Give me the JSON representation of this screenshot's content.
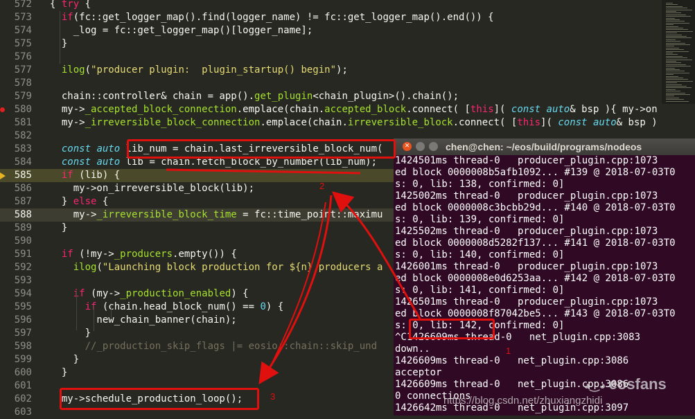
{
  "editor": {
    "lines": [
      {
        "n": "572",
        "html": "<span>{ </span><span class='kw'>try</span><span> {</span>"
      },
      {
        "n": "573",
        "html": "  <span class='kw'>if</span>(fc::get_logger_map().find(logger_name) != fc::get_logger_map().end()) {"
      },
      {
        "n": "574",
        "html": "    _log = fc::get_logger_map()[logger_name];"
      },
      {
        "n": "575",
        "html": "  }"
      },
      {
        "n": "576",
        "html": ""
      },
      {
        "n": "577",
        "html": "  <span class='gr'>ilog</span>(<span class='str'>\"producer plugin:  plugin_startup() begin\"</span>);"
      },
      {
        "n": "578",
        "html": ""
      },
      {
        "n": "579",
        "html": "  chain::controller&amp; chain = app().<span class='gr'>get_plugin</span>&lt;chain_plugin&gt;().chain();"
      },
      {
        "n": "580",
        "html": "  my-&gt;<span class='gr'>_accepted_block_connection</span>.emplace(chain.<span class='gr'>accepted_block</span>.connect( [<span class='kw'>this</span>]( <span class='ty'>const</span> <span class='ty'>auto</span>&amp; bsp ){ my-&gt;on"
      },
      {
        "n": "581",
        "html": "  my-&gt;<span class='gr'>_irreversible_block_connection</span>.emplace(chain.<span class='gr'>irreversible_block</span>.connect( [<span class='kw'>this</span>]( <span class='ty'>const</span> <span class='ty'>auto</span>&amp; bsp )"
      },
      {
        "n": "582",
        "html": ""
      },
      {
        "n": "583",
        "html": "  <span class='ty'>const</span> <span class='ty'>auto</span> lib_num = chain.last_irreversible_block_num("
      },
      {
        "n": "584",
        "html": "  <span class='ty'>const</span> <span class='ty'>auto</span> lib = chain.fetch_block_by_number(lib_num);"
      },
      {
        "n": "585",
        "html": "  <span class='kw'>if</span> (lib) {"
      },
      {
        "n": "586",
        "html": "    my-&gt;on_irreversible_block(lib);"
      },
      {
        "n": "587",
        "html": "  } <span class='kw'>else</span> {"
      },
      {
        "n": "588",
        "html": "    my-&gt;<span class='gr'>_irreversible_block_time</span> = fc::time_point::maximu"
      },
      {
        "n": "589",
        "html": "  }"
      },
      {
        "n": "590",
        "html": ""
      },
      {
        "n": "591",
        "html": "  <span class='kw'>if</span> (!my-&gt;<span class='gr'>_producers</span>.empty()) {"
      },
      {
        "n": "592",
        "html": "    <span class='gr'>ilog</span>(<span class='str'>\"Launching block production for ${n} producers a</span>"
      },
      {
        "n": "593",
        "html": ""
      },
      {
        "n": "594",
        "html": "    <span class='kw'>if</span> (my-&gt;<span class='gr'>_production_enabled</span>) {"
      },
      {
        "n": "595",
        "html": "      <span class='kw'>if</span> (chain.head_block_num() == <span class='fn'>0</span>) {"
      },
      {
        "n": "596",
        "html": "        new_chain_banner(chain);"
      },
      {
        "n": "597",
        "html": "      }"
      },
      {
        "n": "598",
        "html": "      <span class='cm'>//_production_skip_flags |= eosio::chain::skip_und</span>"
      },
      {
        "n": "599",
        "html": "    }"
      },
      {
        "n": "600",
        "html": "  }"
      },
      {
        "n": "601",
        "html": ""
      },
      {
        "n": "602",
        "html": "  my-&gt;schedule_production_loop();"
      },
      {
        "n": "603",
        "html": ""
      }
    ]
  },
  "terminal": {
    "title": "chen@chen: ~/eos/build/programs/nodeos",
    "lines": [
      "1424501ms thread-0   producer_plugin.cpp:1073",
      "ed block 0000008b5afb1092... #139 @ 2018-07-03T0",
      "s: 0, lib: 138, confirmed: 0]",
      "1425002ms thread-0   producer_plugin.cpp:1073",
      "ed block 0000008c3bcbb29d... #140 @ 2018-07-03T0",
      "s: 0, lib: 139, confirmed: 0]",
      "1425502ms thread-0   producer_plugin.cpp:1073",
      "ed block 0000008d5282f137... #141 @ 2018-07-03T0",
      "s: 0, lib: 140, confirmed: 0]",
      "1426001ms thread-0   producer_plugin.cpp:1073",
      "ed block 0000008e0d6253aa... #142 @ 2018-07-03T0",
      "s: 0, lib: 141, confirmed: 0]",
      "1426501ms thread-0   producer_plugin.cpp:1073",
      "ed block 0000008f87042be5... #143 @ 2018-07-03T0",
      "s: 0, lib: 142, confirmed: 0]",
      "^C1426609ms thread-0   net_plugin.cpp:3083",
      "down..",
      "1426609ms thread-0   net_plugin.cpp:3086",
      "acceptor",
      "1426609ms thread-0   net_plugin.cpp:3086",
      "0 connections",
      "1426642ms thread-0   net_plugin.cpp:3097"
    ]
  },
  "annotations": {
    "n1": "1",
    "n2": "2",
    "n3": "3"
  },
  "watermark": {
    "brand": "eosfans",
    "url": "https://blog.csdn.net/zhuxiangzhidi"
  },
  "colors": {
    "annotation": "#e0100f",
    "editor_bg": "#272822",
    "terminal_bg": "#300a24"
  }
}
